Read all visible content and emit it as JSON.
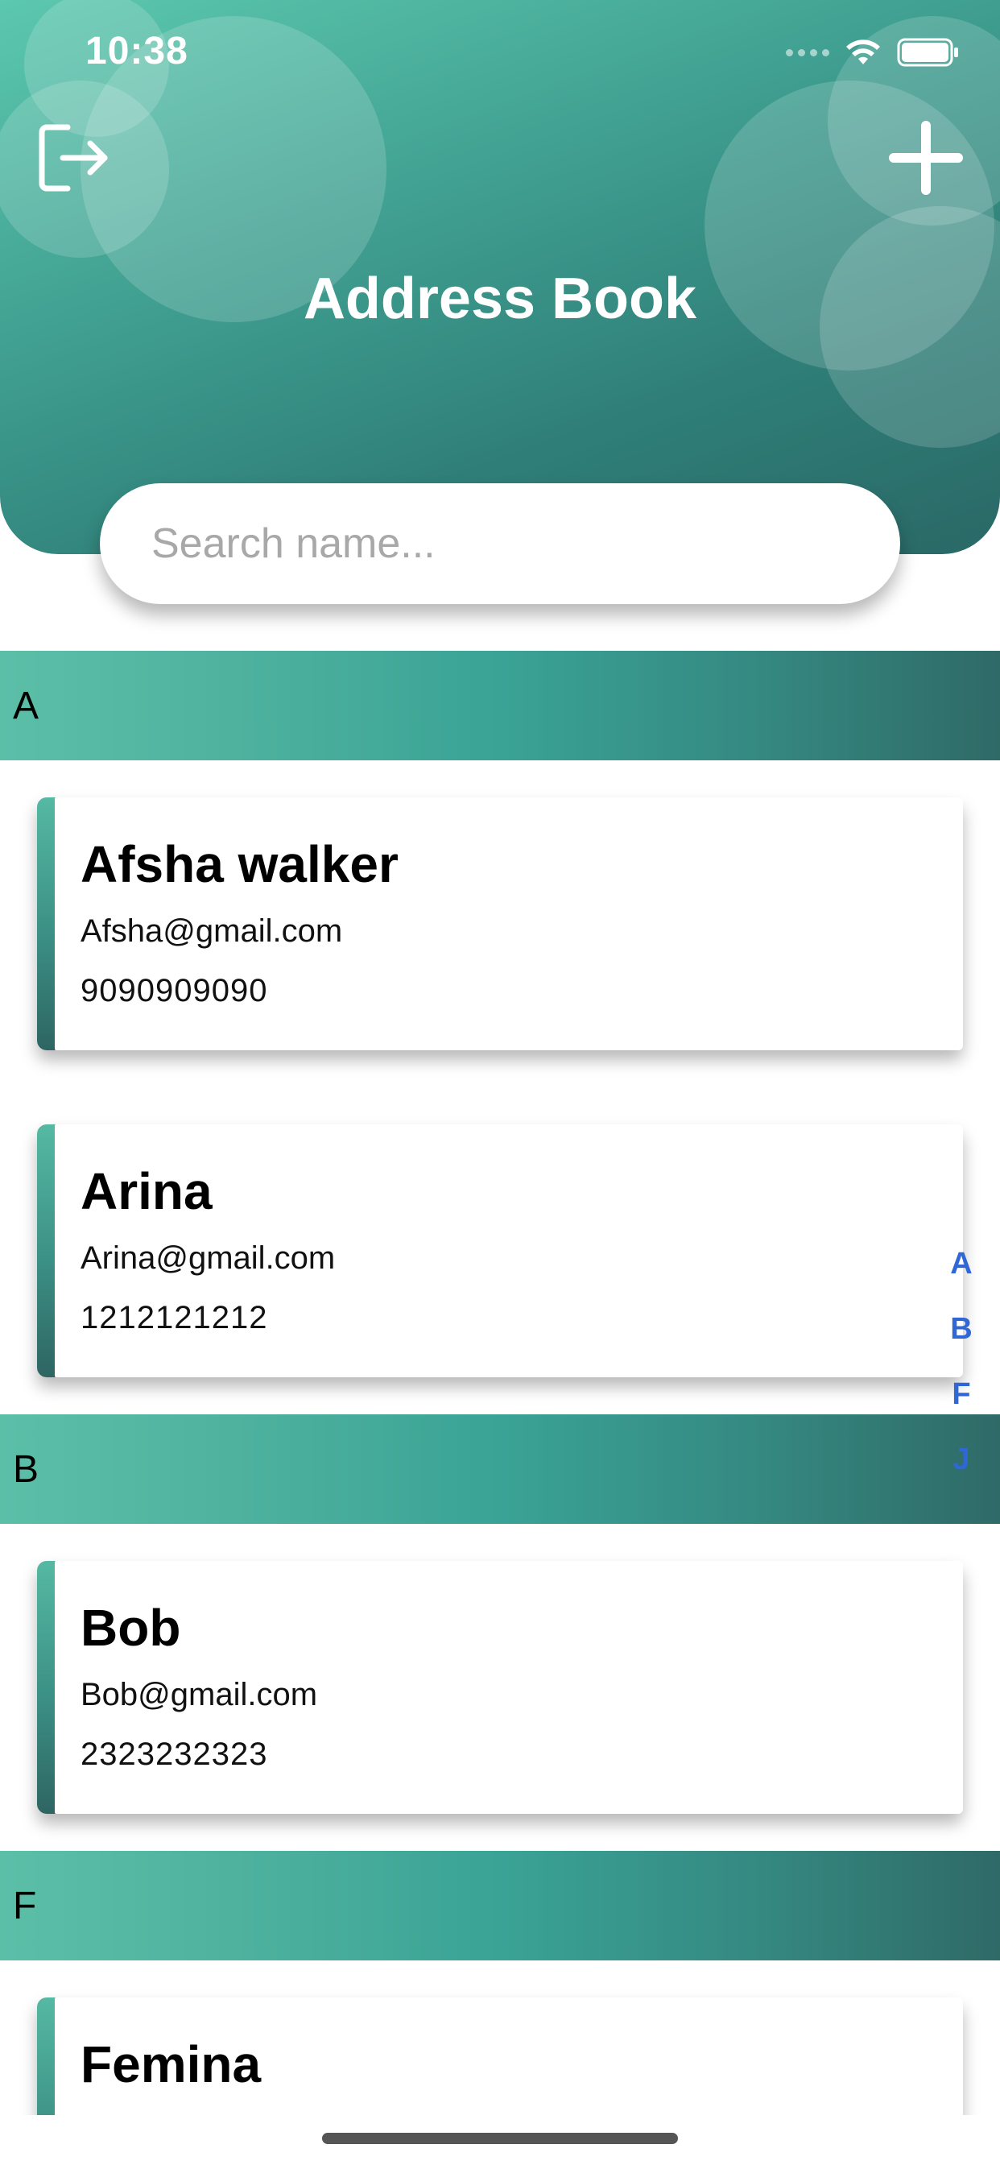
{
  "status_bar": {
    "time": "10:38"
  },
  "header": {
    "title": "Address Book",
    "colors": {
      "gradient_start": "#5cc8ae",
      "gradient_end": "#2a6866"
    }
  },
  "search": {
    "placeholder": "Search name..."
  },
  "sections": [
    {
      "letter": "A",
      "contacts": [
        {
          "name": "Afsha walker",
          "email": "Afsha@gmail.com",
          "phone": "9090909090"
        },
        {
          "name": "Arina",
          "email": "Arina@gmail.com",
          "phone": "1212121212"
        }
      ]
    },
    {
      "letter": "B",
      "contacts": [
        {
          "name": "Bob",
          "email": "Bob@gmail.com",
          "phone": "2323232323"
        }
      ]
    },
    {
      "letter": "F",
      "contacts": [
        {
          "name": "Femina",
          "email": "",
          "phone": ""
        }
      ]
    }
  ],
  "index_bar": [
    "A",
    "B",
    "F",
    "J"
  ],
  "icons": {
    "logout": "logout-icon",
    "add": "plus-icon",
    "wifi": "wifi-icon",
    "battery": "battery-icon"
  }
}
